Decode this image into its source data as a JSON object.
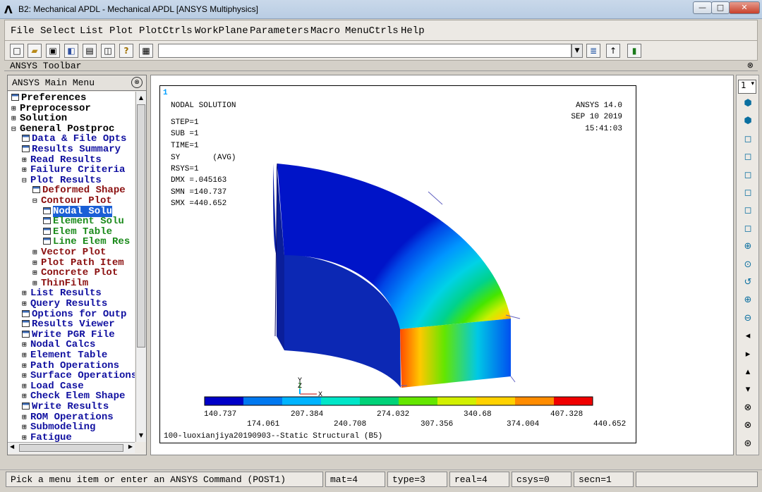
{
  "window": {
    "title": "B2: Mechanical APDL - Mechanical APDL [ANSYS Multiphysics]",
    "logo": "Λ",
    "min": "—",
    "max": "□",
    "close": "✕"
  },
  "menubar": [
    "File",
    "Select",
    "List",
    "Plot",
    "PlotCtrls",
    "WorkPlane",
    "Parameters",
    "Macro",
    "MenuCtrls",
    "Help"
  ],
  "toolbar": {
    "command_value": "",
    "icons": [
      "new-file-icon",
      "open-folder-icon",
      "save-icon",
      "report-icon",
      "print-icon",
      "image-capture-icon",
      "help-icon",
      "keyboard-icon"
    ]
  },
  "ansys_toolbar": {
    "label": "ANSYS Toolbar",
    "collapse": "⊗"
  },
  "main_menu": {
    "title": "ANSYS Main Menu",
    "collapse": "⊗",
    "items": [
      {
        "label": "Preferences",
        "icon": "grid",
        "color": "black",
        "indent": 0
      },
      {
        "label": "Preprocessor",
        "icon": "plus",
        "color": "black",
        "indent": 0
      },
      {
        "label": "Solution",
        "icon": "plus",
        "color": "black",
        "indent": 0
      },
      {
        "label": "General Postproc",
        "icon": "minus",
        "color": "black",
        "indent": 0
      },
      {
        "label": "Data & File Opts",
        "icon": "grid",
        "color": "blue",
        "indent": 1
      },
      {
        "label": "Results Summary",
        "icon": "grid",
        "color": "blue",
        "indent": 1
      },
      {
        "label": "Read Results",
        "icon": "plus",
        "color": "blue",
        "indent": 1
      },
      {
        "label": "Failure Criteria",
        "icon": "plus",
        "color": "blue",
        "indent": 1
      },
      {
        "label": "Plot Results",
        "icon": "minus",
        "color": "blue",
        "indent": 1
      },
      {
        "label": "Deformed Shape",
        "icon": "grid",
        "color": "red",
        "indent": 2
      },
      {
        "label": "Contour Plot",
        "icon": "minus",
        "color": "red",
        "indent": 2
      },
      {
        "label": "Nodal Solu",
        "icon": "grid",
        "color": "green",
        "indent": 3,
        "selected": true
      },
      {
        "label": "Element Solu",
        "icon": "grid",
        "color": "green",
        "indent": 3
      },
      {
        "label": "Elem Table",
        "icon": "grid",
        "color": "green",
        "indent": 3
      },
      {
        "label": "Line Elem Res",
        "icon": "grid",
        "color": "green",
        "indent": 3
      },
      {
        "label": "Vector Plot",
        "icon": "plus",
        "color": "red",
        "indent": 2
      },
      {
        "label": "Plot Path Item",
        "icon": "plus",
        "color": "red",
        "indent": 2
      },
      {
        "label": "Concrete Plot",
        "icon": "plus",
        "color": "red",
        "indent": 2
      },
      {
        "label": "ThinFilm",
        "icon": "plus",
        "color": "red",
        "indent": 2
      },
      {
        "label": "List Results",
        "icon": "plus",
        "color": "blue",
        "indent": 1
      },
      {
        "label": "Query Results",
        "icon": "plus",
        "color": "blue",
        "indent": 1
      },
      {
        "label": "Options for Outp",
        "icon": "grid",
        "color": "blue",
        "indent": 1
      },
      {
        "label": "Results Viewer",
        "icon": "grid",
        "color": "blue",
        "indent": 1
      },
      {
        "label": "Write PGR File",
        "icon": "grid",
        "color": "blue",
        "indent": 1
      },
      {
        "label": "Nodal Calcs",
        "icon": "plus",
        "color": "blue",
        "indent": 1
      },
      {
        "label": "Element Table",
        "icon": "plus",
        "color": "blue",
        "indent": 1
      },
      {
        "label": "Path Operations",
        "icon": "plus",
        "color": "blue",
        "indent": 1
      },
      {
        "label": "Surface Operations",
        "icon": "plus",
        "color": "blue",
        "indent": 1
      },
      {
        "label": "Load Case",
        "icon": "plus",
        "color": "blue",
        "indent": 1
      },
      {
        "label": "Check Elem Shape",
        "icon": "plus",
        "color": "blue",
        "indent": 1
      },
      {
        "label": "Write Results",
        "icon": "grid",
        "color": "blue",
        "indent": 1
      },
      {
        "label": "ROM Operations",
        "icon": "plus",
        "color": "blue",
        "indent": 1
      },
      {
        "label": "Submodeling",
        "icon": "plus",
        "color": "blue",
        "indent": 1
      },
      {
        "label": "Fatigue",
        "icon": "plus",
        "color": "blue",
        "indent": 1
      }
    ]
  },
  "graphics": {
    "window_number": "1",
    "info_lines": [
      "NODAL SOLUTION",
      "STEP=1",
      "SUB =1",
      "TIME=1",
      "SY       (AVG)",
      "RSYS=1",
      "DMX =.045163",
      "SMN =140.737",
      "SMX =440.652"
    ],
    "version": "ANSYS 14.0",
    "date": "SEP 10 2019",
    "time": "15:41:03",
    "legend_values_top": [
      "140.737",
      "207.384",
      "274.032",
      "340.68",
      "407.328"
    ],
    "legend_values_bottom": [
      "174.061",
      "240.708",
      "307.356",
      "374.004",
      "440.652"
    ],
    "legend_colors": [
      "#0000c8",
      "#0078f0",
      "#00b4ff",
      "#00e6c8",
      "#00d278",
      "#64e600",
      "#d2f000",
      "#ffd200",
      "#ff8c00",
      "#f00000"
    ],
    "caption": "100-luoxianjiya20190903--Static Structural (B5)",
    "triad": {
      "y": "Y",
      "z": "Z",
      "x": "X"
    }
  },
  "right_toolbar": {
    "window_select": "1",
    "icons": [
      "iso-view-icon",
      "oblique-view-icon",
      "front-view-icon",
      "right-view-icon",
      "top-view-icon",
      "back-view-icon",
      "left-view-icon",
      "bottom-view-icon",
      "zoom-icon",
      "box-zoom-icon",
      "win-zoom-icon",
      "zoom-in-icon",
      "zoom-out-icon",
      "pan-left-icon",
      "pan-right-icon",
      "pan-up-icon",
      "pan-down-icon",
      "rotate-x-icon",
      "rotate-y-icon",
      "rotate-z-icon"
    ]
  },
  "status": {
    "prompt": "Pick a menu item or enter an ANSYS Command (POST1)",
    "mat": "mat=4",
    "type": "type=3",
    "real": "real=4",
    "csys": "csys=0",
    "secn": "secn=1"
  }
}
